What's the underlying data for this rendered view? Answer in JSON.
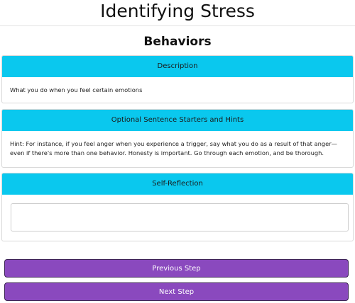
{
  "page": {
    "title": "Identifying Stress",
    "section_title": "Behaviors"
  },
  "description_card": {
    "header": "Description",
    "body": "What you do when you feel certain emotions"
  },
  "hints_card": {
    "header": "Optional Sentence Starters and Hints",
    "body": "Hint: For instance, if you feel anger when you experience a trigger, say what you do as a result of that anger—even if there's more than one behavior. Honesty is important. Go through each emotion, and be thorough."
  },
  "reflection_card": {
    "header": "Self-Reflection",
    "textarea_value": "",
    "textarea_placeholder": ""
  },
  "buttons": {
    "previous_label": "Previous Step",
    "next_label": "Next Step"
  },
  "colors": {
    "card_header": "#0ac8ee",
    "button": "#8a49be",
    "button_border": "#3d2456"
  }
}
